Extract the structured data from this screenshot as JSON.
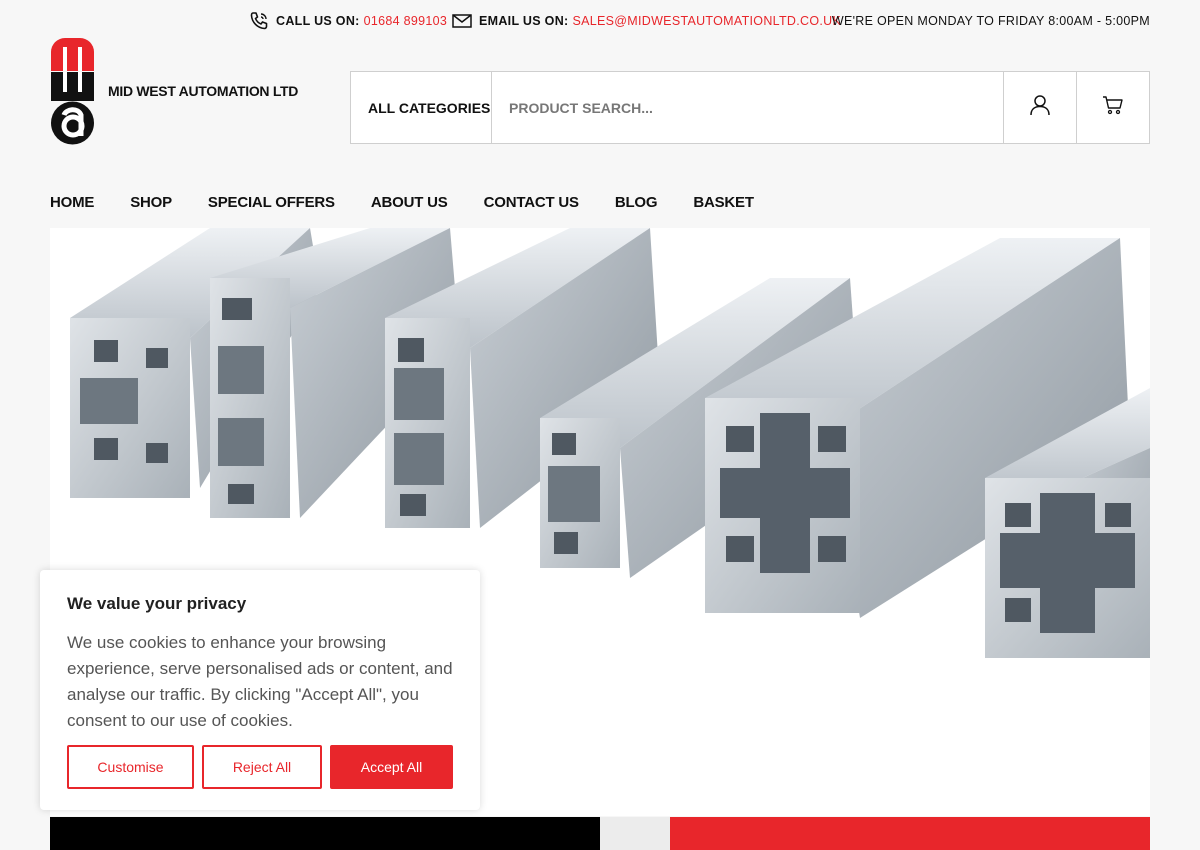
{
  "topbar": {
    "call_label": "CALL US ON:",
    "call_value": "01684 899103",
    "email_label": "EMAIL US ON:",
    "email_value": "SALES@MIDWESTAUTOMATIONLTD.CO.UK",
    "hours": "WE'RE OPEN MONDAY TO FRIDAY 8:00AM - 5:00PM"
  },
  "logo": {
    "text": "MID WEST AUTOMATION LTD"
  },
  "search": {
    "category": "ALL CATEGORIES",
    "placeholder": "PRODUCT SEARCH..."
  },
  "nav": {
    "items": [
      "HOME",
      "SHOP",
      "SPECIAL OFFERS",
      "ABOUT US",
      "CONTACT US",
      "BLOG",
      "BASKET"
    ]
  },
  "cookie": {
    "title": "We value your privacy",
    "text": "We use cookies to enhance your browsing experience, serve personalised ads or content, and analyse our traffic. By clicking \"Accept All\", you consent to our use of cookies.",
    "customise": "Customise",
    "reject": "Reject All",
    "accept": "Accept All"
  },
  "colors": {
    "accent": "#e8262b",
    "text": "#111111",
    "background": "#f7f7f7"
  },
  "icons": [
    "phone-icon",
    "envelope-icon",
    "user-icon",
    "cart-icon"
  ]
}
